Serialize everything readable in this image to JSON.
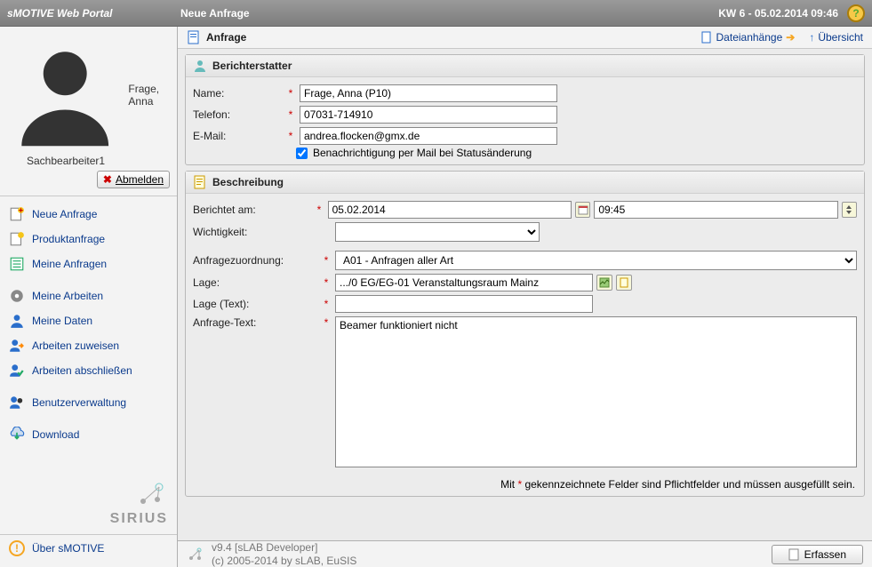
{
  "header": {
    "portal_name": "sMOTIVE Web Portal",
    "page_title": "Neue Anfrage",
    "date_info": "KW 6 - 05.02.2014 09:46"
  },
  "user": {
    "name": "Frage, Anna",
    "role": "Sachbearbeiter1",
    "logout": "Abmelden"
  },
  "nav": {
    "items": [
      {
        "label": "Neue Anfrage"
      },
      {
        "label": "Produktanfrage"
      },
      {
        "label": "Meine Anfragen"
      },
      {
        "label": "Meine Arbeiten"
      },
      {
        "label": "Meine Daten"
      },
      {
        "label": "Arbeiten zuweisen"
      },
      {
        "label": "Arbeiten abschließen"
      },
      {
        "label": "Benutzerverwaltung"
      },
      {
        "label": "Download"
      }
    ],
    "brand": "SIRIUS",
    "about": "Über sMOTIVE"
  },
  "toolbar": {
    "title": "Anfrage",
    "attachments": "Dateianhänge",
    "overview": "Übersicht"
  },
  "sections": {
    "reporter": "Berichterstatter",
    "description": "Beschreibung"
  },
  "labels": {
    "name": "Name:",
    "phone": "Telefon:",
    "email": "E-Mail:",
    "notify": "Benachrichtigung per Mail bei Statusänderung",
    "reported_at": "Berichtet am:",
    "priority": "Wichtigkeit:",
    "assignment": "Anfragezuordnung:",
    "location": "Lage:",
    "location_text": "Lage (Text):",
    "request_text": "Anfrage-Text:"
  },
  "values": {
    "name": "Frage, Anna (P10)",
    "phone": "07031-714910",
    "email": "andrea.flocken@gmx.de",
    "notify_checked": true,
    "reported_date": "05.02.2014",
    "reported_time": "09:45",
    "priority": "",
    "assignment": "A01 - Anfragen aller Art",
    "location": ".../0 EG/EG-01 Veranstaltungsraum Mainz",
    "location_text": "",
    "request_text": "Beamer funktioniert nicht"
  },
  "hint": {
    "prefix": "Mit ",
    "suffix": " gekennzeichnete Felder sind Pflichtfelder und müssen ausgefüllt sein."
  },
  "footer": {
    "version": "v9.4 [sLAB Developer]",
    "copyright": "(c) 2005-2014 by sLAB, EuSIS",
    "submit": "Erfassen"
  }
}
